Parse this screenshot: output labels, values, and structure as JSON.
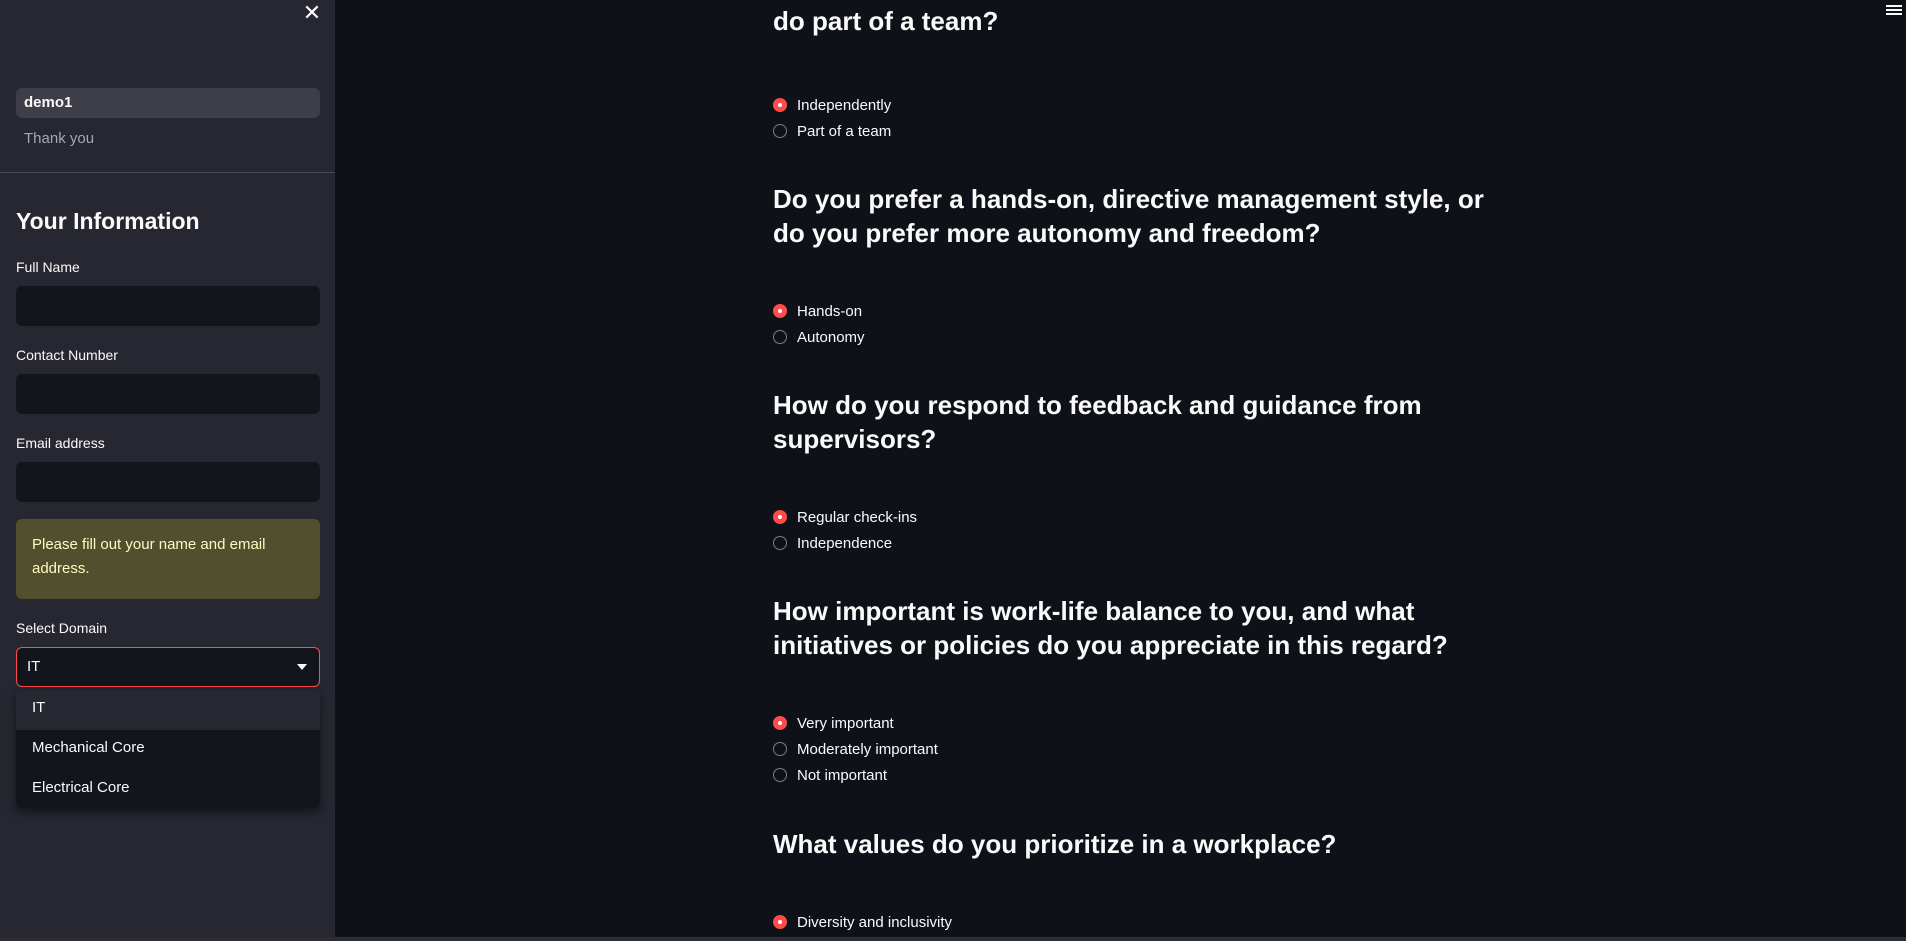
{
  "sidebar": {
    "nav": [
      {
        "label": "demo1",
        "active": true
      },
      {
        "label": "Thank you",
        "active": false
      }
    ],
    "heading": "Your Information",
    "fields": {
      "full_name": {
        "label": "Full Name",
        "value": ""
      },
      "contact_number": {
        "label": "Contact Number",
        "value": ""
      },
      "email": {
        "label": "Email address",
        "value": ""
      }
    },
    "warning": "Please fill out your name and email address.",
    "select": {
      "label": "Select Domain",
      "value": "IT",
      "options": [
        "IT",
        "Mechanical Core",
        "Electrical Core"
      ]
    },
    "close_icon": "close-icon"
  },
  "main": {
    "menu_icon": "hamburger-icon",
    "partial_question": "do part of a team?",
    "questions": [
      {
        "text": "",
        "options": [
          {
            "label": "Independently",
            "checked": true
          },
          {
            "label": "Part of a team",
            "checked": false
          }
        ]
      },
      {
        "text": "Do you prefer a hands-on, directive management style, or do you prefer more autonomy and freedom?",
        "options": [
          {
            "label": "Hands-on",
            "checked": true
          },
          {
            "label": "Autonomy",
            "checked": false
          }
        ]
      },
      {
        "text": "How do you respond to feedback and guidance from supervisors?",
        "options": [
          {
            "label": "Regular check-ins",
            "checked": true
          },
          {
            "label": "Independence",
            "checked": false
          }
        ]
      },
      {
        "text": "How important is work-life balance to you, and what initiatives or policies do you appreciate in this regard?",
        "options": [
          {
            "label": "Very important",
            "checked": true
          },
          {
            "label": "Moderately important",
            "checked": false
          },
          {
            "label": "Not important",
            "checked": false
          }
        ]
      },
      {
        "text": "What values do you prioritize in a workplace?",
        "options": [
          {
            "label": "Diversity and inclusivity",
            "checked": true
          }
        ]
      }
    ]
  },
  "colors": {
    "accent": "#ff4b4b",
    "background": "#0e1117",
    "sidebar": "#262730",
    "warning_bg": "#514f2d",
    "warning_text": "#fff9c4"
  }
}
